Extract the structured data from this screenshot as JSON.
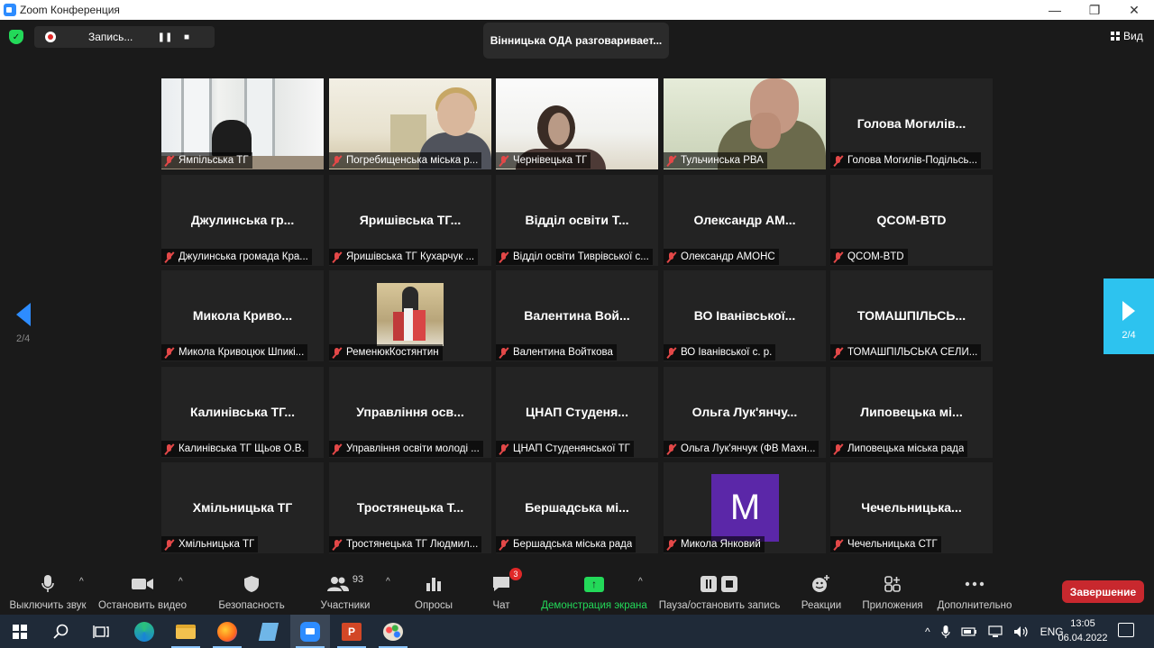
{
  "window": {
    "title": "Zoom Конференция",
    "minimize_glyph": "—",
    "restore_glyph": "❐",
    "close_glyph": "✕"
  },
  "topbar": {
    "recording_label": "Запись...",
    "pause_glyph": "❚❚",
    "stop_glyph": "■",
    "speaking_banner": "Вінницька ОДА разговаривает...",
    "view_label": "Вид"
  },
  "pagination": {
    "left_page": "2/4",
    "right_page": "2/4"
  },
  "tiles": [
    {
      "big": "",
      "label": "Ямпільська ТГ",
      "video": "room"
    },
    {
      "big": "",
      "label": "Погребищенська міська р...",
      "video": "woman1"
    },
    {
      "big": "",
      "label": "Чернівецька ТГ",
      "video": "woman2"
    },
    {
      "big": "",
      "label": "Тульчинська РВА",
      "video": "man"
    },
    {
      "big": "Голова Могилів...",
      "label": "Голова Могилів-Подільсь...",
      "video": ""
    },
    {
      "big": "Джулинська гр...",
      "label": "Джулинська громада Кра...",
      "video": ""
    },
    {
      "big": "Яришівська ТГ...",
      "label": "Яришівська ТГ Кухарчук ...",
      "video": ""
    },
    {
      "big": "Відділ освіти Т...",
      "label": "Відділ освіти Тиврівської с...",
      "video": ""
    },
    {
      "big": "Олександр AM...",
      "label": "Олександр AMOHC",
      "video": ""
    },
    {
      "big": "QCOM-BTD",
      "label": "QCOM-BTD",
      "video": ""
    },
    {
      "big": "Микола Криво...",
      "label": "Микола Кривоцюк Шпикі...",
      "video": ""
    },
    {
      "big": "",
      "label": "РеменюкКостянтин",
      "video": "photo"
    },
    {
      "big": "Валентина Вой...",
      "label": "Валентина Войткова",
      "video": ""
    },
    {
      "big": "ВО Іванівської...",
      "label": "ВО Іванівської с. р.",
      "video": ""
    },
    {
      "big": "ТОМАШПІЛЬСЬ...",
      "label": "ТОМАШПІЛЬСЬКА СЕЛИ...",
      "video": ""
    },
    {
      "big": "Калинівська ТГ...",
      "label": "Калинівська ТГ Щьов О.В.",
      "video": ""
    },
    {
      "big": "Управління осв...",
      "label": "Управління освіти молоді ...",
      "video": ""
    },
    {
      "big": "ЦНАП Студеня...",
      "label": "ЦНАП Студенянської ТГ",
      "video": ""
    },
    {
      "big": "Ольга Лук'янчу...",
      "label": "Ольга Лук'янчук (ФВ Махн...",
      "video": ""
    },
    {
      "big": "Липовецька мі...",
      "label": "Липовецька міська рада",
      "video": ""
    },
    {
      "big": "Хмільницька ТГ",
      "label": "Хмільницька ТГ",
      "video": ""
    },
    {
      "big": "Тростянецька Т...",
      "label": "Тростянецька ТГ Людмил...",
      "video": ""
    },
    {
      "big": "Бершадська мі...",
      "label": "Бершадська міська рада",
      "video": ""
    },
    {
      "big": "",
      "label": "Микола Янковий",
      "video": "avatar",
      "avatar_letter": "M"
    },
    {
      "big": "Чечельницька...",
      "label": "Чечельницька СТГ",
      "video": ""
    }
  ],
  "toolbar": {
    "mute_label": "Выключить звук",
    "video_label": "Остановить видео",
    "security_label": "Безопасность",
    "participants_label": "Участники",
    "participants_count": "93",
    "polls_label": "Опросы",
    "chat_label": "Чат",
    "chat_badge": "3",
    "share_label": "Демонстрация экрана",
    "record_label": "Пауза/остановить запись",
    "reactions_label": "Реакции",
    "apps_label": "Приложения",
    "more_label": "Дополнительно",
    "end_label": "Завершение"
  },
  "taskbar": {
    "ppt_letter": "P",
    "lang": "ENG",
    "time": "13:05",
    "date": "06.04.2022"
  },
  "colors": {
    "accent_blue": "#2d8cff",
    "share_green": "#23d959",
    "end_red": "#c8282e",
    "avatar_purple": "#5b27a8"
  }
}
